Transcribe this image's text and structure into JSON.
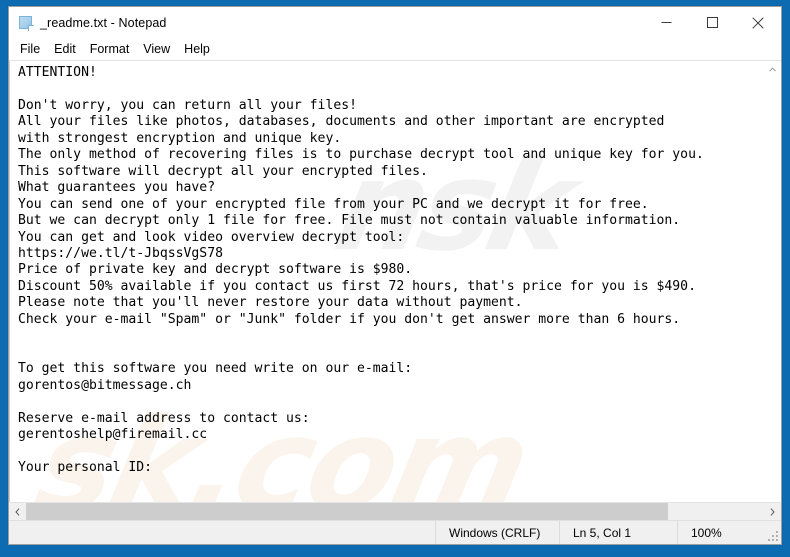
{
  "window": {
    "title": "_readme.txt - Notepad",
    "icon": "notepad-document-icon",
    "controls": {
      "minimize_label": "Minimize",
      "maximize_label": "Maximize",
      "close_label": "Close"
    }
  },
  "menu": {
    "items": [
      {
        "label": "File"
      },
      {
        "label": "Edit"
      },
      {
        "label": "Format"
      },
      {
        "label": "View"
      },
      {
        "label": "Help"
      }
    ]
  },
  "document": {
    "filename": "_readme.txt",
    "body": "ATTENTION!\n\nDon't worry, you can return all your files!\nAll your files like photos, databases, documents and other important are encrypted\nwith strongest encryption and unique key.\nThe only method of recovering files is to purchase decrypt tool and unique key for you.\nThis software will decrypt all your encrypted files.\nWhat guarantees you have?\nYou can send one of your encrypted file from your PC and we decrypt it for free.\nBut we can decrypt only 1 file for free. File must not contain valuable information.\nYou can get and look video overview decrypt tool:\nhttps://we.tl/t-JbqssVgS78\nPrice of private key and decrypt software is $980.\nDiscount 50% available if you contact us first 72 hours, that's price for you is $490.\nPlease note that you'll never restore your data without payment.\nCheck your e-mail \"Spam\" or \"Junk\" folder if you don't get answer more than 6 hours.\n\n\nTo get this software you need write on our e-mail:\ngorentos@bitmessage.ch\n\nReserve e-mail address to contact us:\ngerentoshelp@firemail.cc\n\nYour personal ID:",
    "lines": [
      "ATTENTION!",
      "",
      "Don't worry, you can return all your files!",
      "All your files like photos, databases, documents and other important are encrypted",
      "with strongest encryption and unique key.",
      "The only method of recovering files is to purchase decrypt tool and unique key for you.",
      "This software will decrypt all your encrypted files.",
      "What guarantees you have?",
      "You can send one of your encrypted file from your PC and we decrypt it for free.",
      "But we can decrypt only 1 file for free. File must not contain valuable information.",
      "You can get and look video overview decrypt tool:",
      "https://we.tl/t-JbqssVgS78",
      "Price of private key and decrypt software is $980.",
      "Discount 50% available if you contact us first 72 hours, that's price for you is $490.",
      "Please note that you'll never restore your data without payment.",
      "Check your e-mail \"Spam\" or \"Junk\" folder if you don't get answer more than 6 hours.",
      "",
      "",
      "To get this software you need write on our e-mail:",
      "gorentos@bitmessage.ch",
      "",
      "Reserve e-mail address to contact us:",
      "gerentoshelp@firemail.cc",
      "",
      "Your personal ID:"
    ],
    "details": {
      "video_url": "https://we.tl/t-JbqssVgS78",
      "price_full": "$980",
      "price_discounted": "$490",
      "discount_percent": "50%",
      "discount_window": "72 hours",
      "response_time": "6 hours",
      "primary_email": "gorentos@bitmessage.ch",
      "reserve_email": "gerentoshelp@firemail.cc",
      "free_files": "1 file"
    }
  },
  "scrollbars": {
    "vertical_up_arrow": "scroll-up-icon",
    "horizontal_left_arrow": "scroll-left-icon",
    "horizontal_right_arrow": "scroll-right-icon"
  },
  "status_bar": {
    "encoding": "Windows (CRLF)",
    "position": "Ln 5, Col 1",
    "zoom": "100%"
  },
  "watermark": {
    "top_text": "nsk",
    "bottom_text": "sk.com"
  },
  "colors": {
    "desktop": "#0d6cb1",
    "window_bg": "#ffffff",
    "text": "#000000",
    "status_bg": "#f0f0f0",
    "scroll_thumb": "#cdcdcd"
  }
}
